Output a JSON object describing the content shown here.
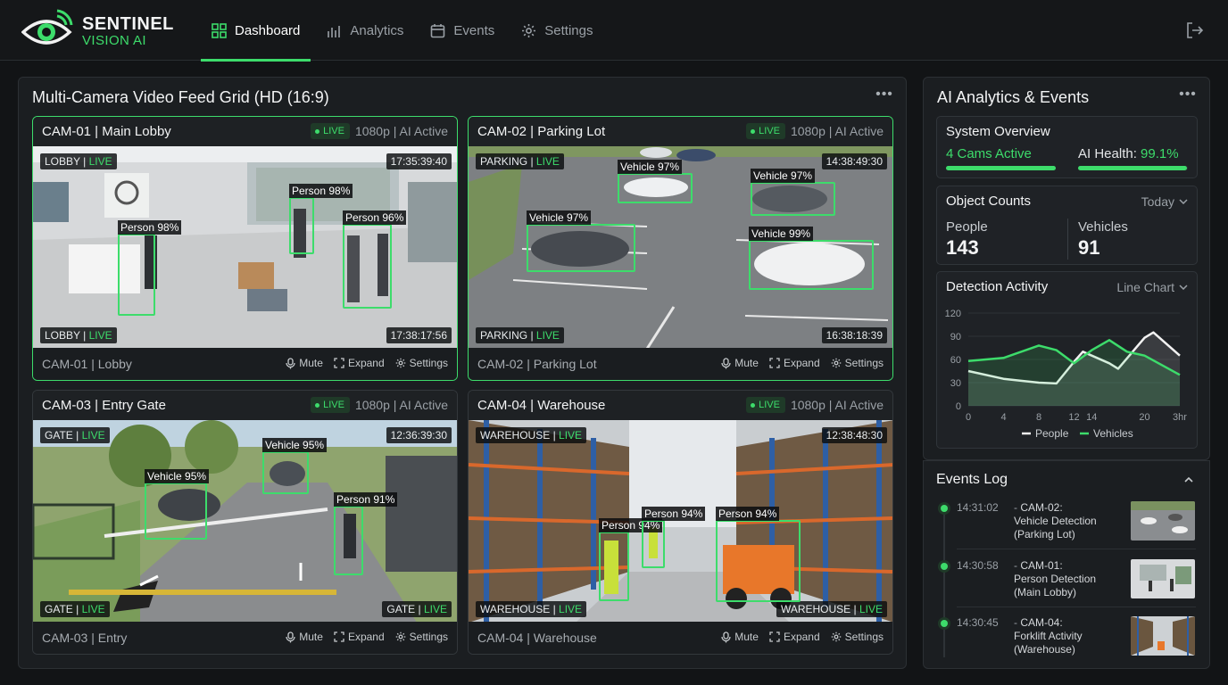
{
  "app": {
    "name_line1": "SENTINEL",
    "name_line2": "VISION AI"
  },
  "nav": [
    {
      "label": "Dashboard",
      "icon": "grid-icon",
      "active": true
    },
    {
      "label": "Analytics",
      "icon": "bar-chart-icon",
      "active": false
    },
    {
      "label": "Events",
      "icon": "calendar-icon",
      "active": false
    },
    {
      "label": "Settings",
      "icon": "gear-icon",
      "active": false
    }
  ],
  "feed": {
    "title": "Multi-Camera Video Feed Grid (HD (16:9)",
    "live": "LIVE",
    "quality": "1080p | AI Active",
    "controls": {
      "mute": "Mute",
      "expand": "Expand",
      "settings": "Settings"
    },
    "cams": [
      {
        "title": "CAM-01 | Main Lobby",
        "footer": "CAM-01 | Lobby",
        "tag": "LOBBY",
        "time_top": "17:35:39:40",
        "time_bottom": "17:38:17:56",
        "detections": [
          "Person 98%",
          "Person 98%",
          "Person 96%"
        ]
      },
      {
        "title": "CAM-02 | Parking Lot",
        "footer": "CAM-02 | Parking Lot",
        "tag": "PARKING",
        "time_top": "14:38:49:30",
        "time_bottom": "16:38:18:39",
        "detections": [
          "Vehicle 97%",
          "Vehicle 97%",
          "Vehicle 97%",
          "Vehicle 99%"
        ]
      },
      {
        "title": "CAM-03 | Entry Gate",
        "footer": "CAM-03 | Entry",
        "tag": "GATE",
        "time_top": "12:36:39:30",
        "detections": [
          "Vehicle 95%",
          "Vehicle 95%",
          "Person 91%"
        ]
      },
      {
        "title": "CAM-04 | Warehouse",
        "footer": "CAM-04 | Warehouse",
        "tag": "WAREHOUSE",
        "time_top": "12:38:48:30",
        "detections": [
          "Person 94%",
          "Person 94%",
          "Person 94%"
        ]
      }
    ]
  },
  "analytics": {
    "title": "AI Analytics & Events",
    "overview": {
      "title": "System Overview",
      "cams_active": "4 Cams Active",
      "ai_health_label": "AI Health:",
      "ai_health_value": "99.1%",
      "cams_fill": 1.0,
      "health_fill": 0.991
    },
    "counts": {
      "title": "Object Counts",
      "period": "Today",
      "people_label": "People",
      "people_value": "143",
      "vehicles_label": "Vehicles",
      "vehicles_value": "91"
    },
    "activity": {
      "title": "Detection Activity",
      "view": "Line Chart"
    }
  },
  "chart_data": {
    "type": "line",
    "x": [
      0,
      4,
      8,
      12,
      14,
      20,
      24
    ],
    "x_tick_labels": [
      "0",
      "4",
      "8",
      "12",
      "14",
      "20",
      "3hr"
    ],
    "y_ticks": [
      0,
      30,
      60,
      90,
      120
    ],
    "ylim": [
      0,
      120
    ],
    "xlim": [
      0,
      24
    ],
    "series": [
      {
        "name": "People",
        "color": "#f2f2f2",
        "points": [
          [
            0,
            45
          ],
          [
            4,
            35
          ],
          [
            8,
            30
          ],
          [
            10,
            29
          ],
          [
            12,
            57
          ],
          [
            13,
            70
          ],
          [
            16,
            55
          ],
          [
            17,
            48
          ],
          [
            20,
            88
          ],
          [
            21,
            95
          ],
          [
            24,
            65
          ]
        ]
      },
      {
        "name": "Vehicles",
        "color": "#3ddc6b",
        "points": [
          [
            0,
            58
          ],
          [
            4,
            62
          ],
          [
            8,
            78
          ],
          [
            10,
            72
          ],
          [
            12,
            55
          ],
          [
            14,
            72
          ],
          [
            16,
            85
          ],
          [
            18,
            70
          ],
          [
            20,
            65
          ],
          [
            24,
            40
          ]
        ]
      }
    ],
    "legend": "bottom",
    "grid": true
  },
  "events": {
    "title": "Events Log",
    "items": [
      {
        "time": "14:31:02",
        "lines": [
          "CAM-02:",
          "Vehicle Detection",
          "(Parking Lot)"
        ],
        "thumb": "parking"
      },
      {
        "time": "14:30:58",
        "lines": [
          "CAM-01:",
          "Person Detection",
          "(Main Lobby)"
        ],
        "thumb": "lobby"
      },
      {
        "time": "14:30:45",
        "lines": [
          "CAM-04:",
          "Forklift Activity",
          "(Warehouse)"
        ],
        "thumb": "warehouse"
      }
    ]
  }
}
